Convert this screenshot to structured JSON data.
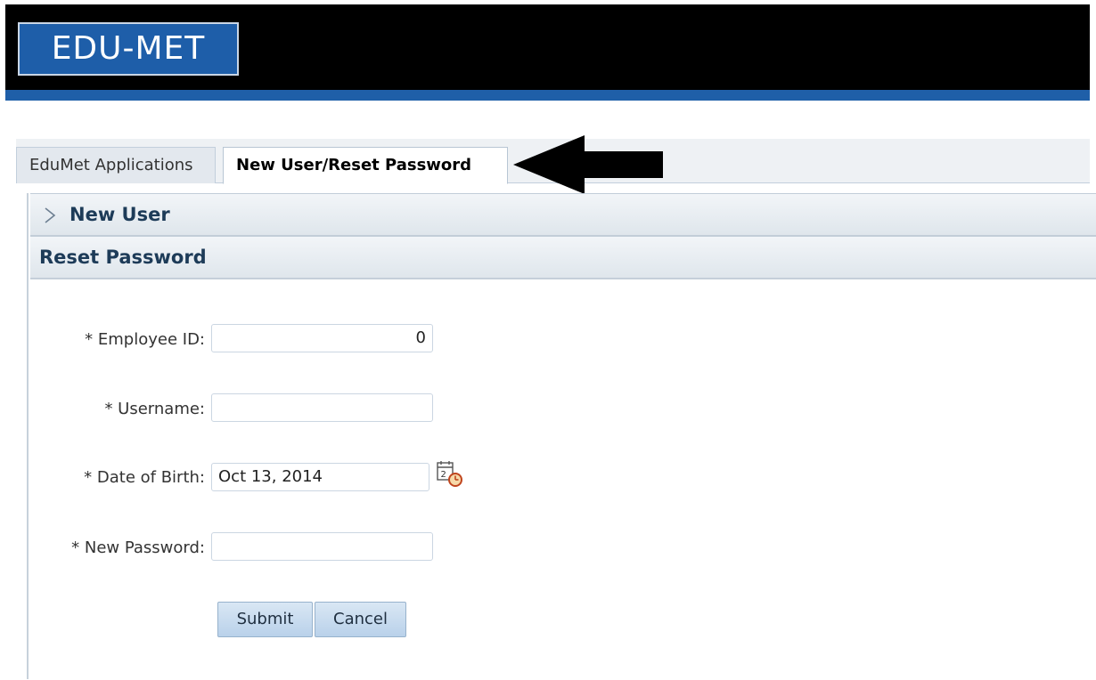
{
  "header": {
    "logo_text": "EDU-MET"
  },
  "tabs": [
    {
      "label": "EduMet Applications",
      "active": false
    },
    {
      "label": "New User/Reset Password",
      "active": true
    }
  ],
  "accordion": {
    "new_user": {
      "label": "New User",
      "expanded": false
    },
    "reset_password": {
      "label": "Reset Password",
      "expanded": true
    }
  },
  "form": {
    "employee_id": {
      "label": "* Employee ID:",
      "value": "0"
    },
    "username": {
      "label": "* Username:",
      "value": ""
    },
    "date_of_birth": {
      "label": "* Date of Birth:",
      "value": "Oct 13, 2014"
    },
    "new_password": {
      "label": "* New Password:",
      "value": ""
    }
  },
  "buttons": {
    "submit": "Submit",
    "cancel": "Cancel"
  },
  "icons": {
    "calendar": "calendar-clock-icon",
    "chevron": "chevron-right-icon",
    "arrow": "left-arrow-icon"
  },
  "colors": {
    "header_bg": "#000000",
    "header_stripe": "#1f5fa8",
    "logo_bg": "#1e5ea9",
    "accordion_text": "#1d3b58"
  }
}
